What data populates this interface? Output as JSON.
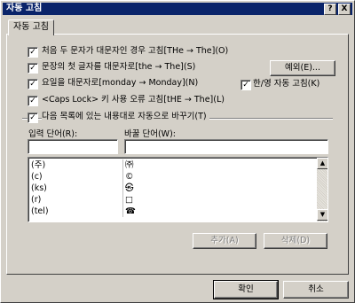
{
  "window": {
    "title": "자동 고침",
    "help_btn": "?",
    "close_btn": "X"
  },
  "tab": {
    "label": "자동 고침"
  },
  "options": [
    {
      "label": "처음 두 문자가 대문자인 경우 고침[THe → The](O)",
      "checked": true
    },
    {
      "label": "문장의 첫 글자를 대문자로[the → The](S)",
      "checked": true
    },
    {
      "label": "요일을 대문자로[monday → Monday](N)",
      "checked": true
    },
    {
      "label": "<Caps Lock> 키 사용 오류 고침[tHE → The](L)",
      "checked": true
    },
    {
      "label": "다음 목록에 있는 내용대로 자동으로 바꾸기(T)",
      "checked": true
    }
  ],
  "exceptions_btn": "예외(E)...",
  "hanyoung": {
    "label": "한/영 자동 고침(K)",
    "checked": true
  },
  "fields": {
    "input_label": "입력 단어(R):",
    "replace_label": "바꿀 단어(W):",
    "input_value": "",
    "replace_value": ""
  },
  "list": [
    {
      "input": "(주)",
      "replace": "㈜"
    },
    {
      "input": "(c)",
      "replace": "©"
    },
    {
      "input": "(ks)",
      "replace": "㉿"
    },
    {
      "input": "(r)",
      "replace": "□"
    },
    {
      "input": "(tel)",
      "replace": "☎"
    }
  ],
  "add_btn": "추가(A)",
  "delete_btn": "삭제(D)",
  "ok_btn": "확인",
  "cancel_btn": "취소",
  "scroll": {
    "up": "▲",
    "down": "▼"
  }
}
